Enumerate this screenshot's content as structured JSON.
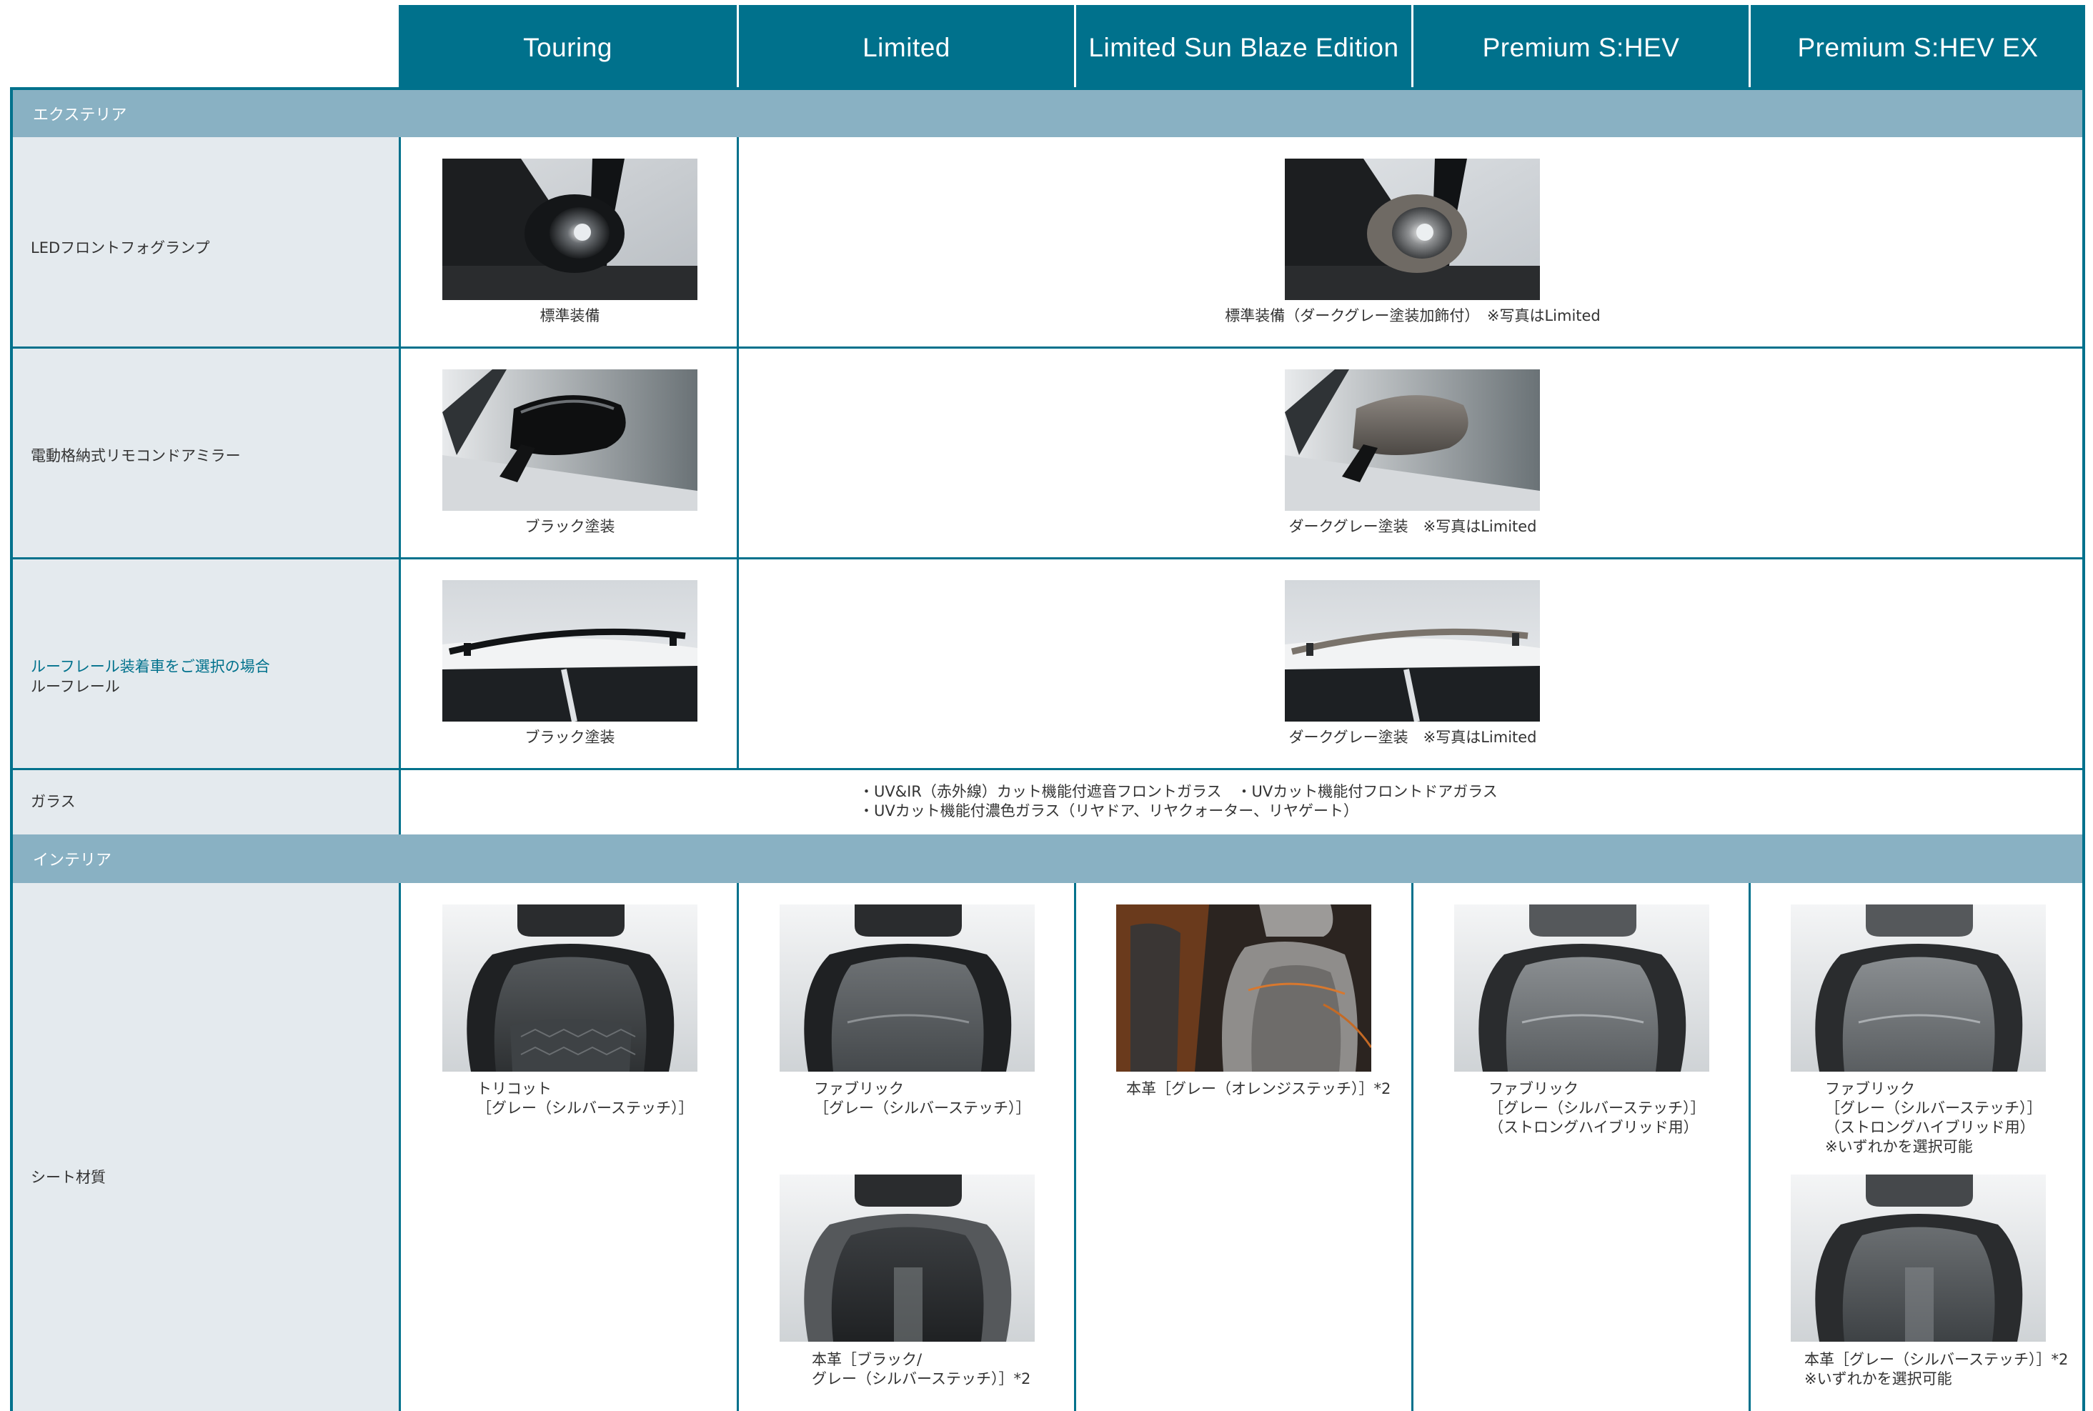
{
  "grades": [
    "Touring",
    "Limited",
    "Limited Sun Blaze Edition",
    "Premium S:HEV",
    "Premium S:HEV EX"
  ],
  "sections": {
    "exterior": "エクステリア",
    "interior": "インテリア"
  },
  "rows": {
    "fog": {
      "label": "LEDフロントフォグランプ",
      "touring_caption": "標準装備",
      "others_caption": "標準装備（ダークグレー塗装加飾付）　※写真はLimited"
    },
    "mirror": {
      "label": "電動格納式リモコンドアミラー",
      "touring_caption": "ブラック塗装",
      "others_caption": "ダークグレー塗装　※写真はLimited"
    },
    "roofrail": {
      "label_note": "ルーフレール装着車をご選択の場合",
      "label": "ルーフレール",
      "touring_caption": "ブラック塗装",
      "others_caption": "ダークグレー塗装　※写真はLimited"
    },
    "glass": {
      "label": "ガラス",
      "line1": "・UV&IR（赤外線）カット機能付遮音フロントガラス　・UVカット機能付フロントドアガラス",
      "line2": "・UVカット機能付濃色ガラス（リヤドア、リヤクォーター、リヤゲート）"
    },
    "seat": {
      "label": "シート材質",
      "touring": "トリコット\n［グレー（シルバーステッチ）］",
      "limited_1": "ファブリック\n［グレー（シルバーステッチ）］",
      "limited_2": "本革［ブラック/\nグレー（シルバーステッチ）］*2",
      "sunblaze": "本革［グレー（オレンジステッチ）］*2",
      "premium": "ファブリック\n［グレー（シルバーステッチ）］\n（ストロングハイブリッド用）",
      "premium_ex_1": "ファブリック\n［グレー（シルバーステッチ）］\n（ストロングハイブリッド用）\n※いずれかを選択可能",
      "premium_ex_2": "本革［グレー（シルバーステッチ）］*2\n※いずれかを選択可能"
    }
  },
  "colors": {
    "header": "#00718c",
    "section_bar": "#89b1c3",
    "label_bg": "#e4eaee",
    "accent_text": "#00718c"
  }
}
